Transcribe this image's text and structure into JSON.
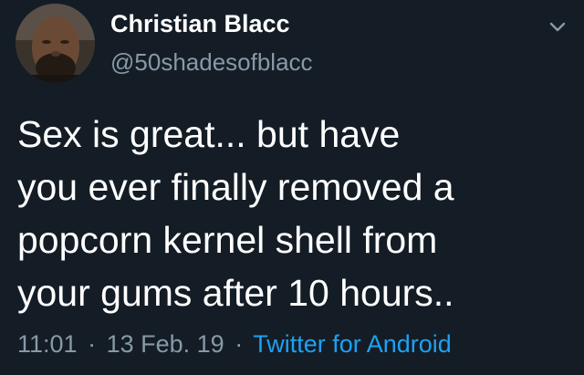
{
  "user": {
    "display_name": "Christian Blacc",
    "handle": "@50shadesofblacc",
    "avatar_icon": "avatar-photo"
  },
  "tweet": {
    "lines": [
      "Sex is great... but have",
      "you ever finally removed a",
      "popcorn kernel shell from",
      "your gums after 10 hours.."
    ],
    "time": "11:01",
    "date": "13 Feb. 19",
    "separator": "·",
    "source": "Twitter for Android"
  },
  "menu": {
    "icon": "chevron-down-icon"
  },
  "colors": {
    "background": "#141d26",
    "text": "#ffffff",
    "muted": "#8899a6",
    "link": "#1da1f2"
  }
}
